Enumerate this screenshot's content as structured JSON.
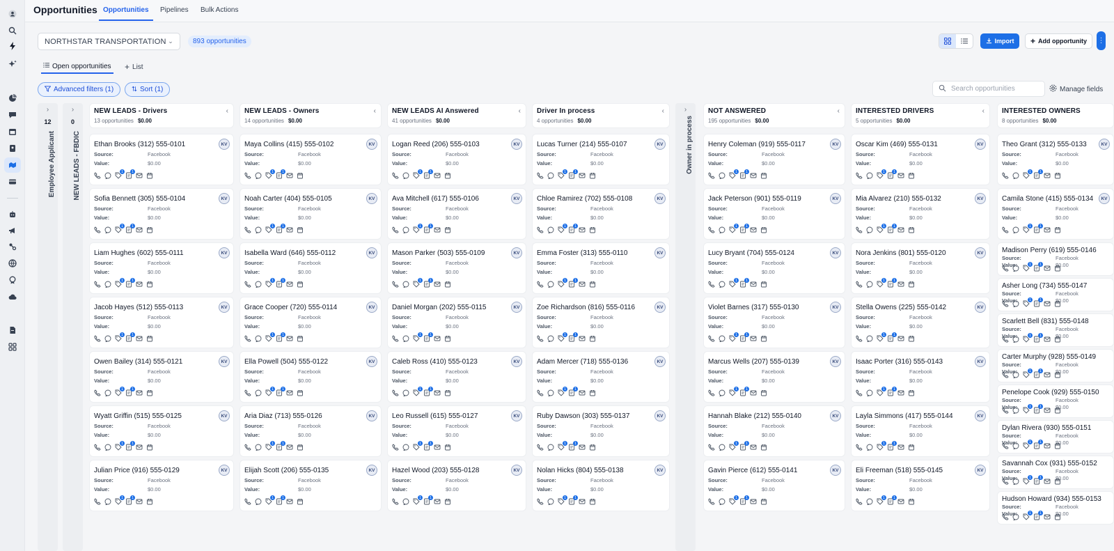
{
  "header": {
    "title": "Opportunities",
    "tabs": [
      "Opportunities",
      "Pipelines",
      "Bulk Actions"
    ]
  },
  "toolbar": {
    "pipeline": "NORTHSTAR TRANSPORTATION",
    "count": "893 opportunities",
    "import_label": "Import",
    "add_label": "Add opportunity"
  },
  "views": {
    "open": "Open opportunities",
    "list": "List"
  },
  "filters": {
    "advanced": "Advanced filters (1)",
    "sort": "Sort (1)",
    "search_placeholder": "Search opportunities",
    "manage_fields": "Manage fields"
  },
  "collapsed_columns": [
    {
      "label": "Employee Applicant",
      "count": "12"
    },
    {
      "label": "NEW LEADS - FBDIC",
      "count": "0"
    },
    {
      "label": "Owner in process",
      "count": ""
    }
  ],
  "card_labels": {
    "source": "Source:",
    "value": "Value:",
    "source_value": "Facebook",
    "amount": "$0.00",
    "avatar": "KV"
  },
  "columns": [
    {
      "title": "NEW LEADS - Drivers",
      "count": "13 opportunities",
      "amount": "$0.00",
      "cards": [
        "Ethan Brooks (312) 555-0101",
        "Liam Hughes (602) 555-0111"
      ]
    },
    {
      "title": "NEW LEADS - Owners",
      "count": "14 opportunities",
      "amount": "$0.00",
      "cards": []
    },
    {
      "title": "NEW LEADS AI Answered",
      "count": "41 opportunities",
      "amount": "$0.00",
      "cards": []
    },
    {
      "title": "Driver In process",
      "count": "4 opportunities",
      "amount": "$0.00",
      "cards": []
    },
    {
      "title": "NOT ANSWERED",
      "count": "195 opportunities",
      "amount": "$0.00",
      "cards": []
    },
    {
      "title": "INTERESTED DRIVERS",
      "count": "5 opportunities",
      "amount": "$0.00",
      "cards": []
    },
    {
      "title": "INTERESTED OWNERS",
      "count": "8 opportunities",
      "amount": "$0.00",
      "cards": []
    }
  ],
  "cards": {
    "col0": [
      "Ethan Brooks (312) 555-0101",
      "Sofia Bennett (305) 555-0104",
      "Liam Hughes (602) 555-0111",
      "Jacob Hayes (512) 555-0113",
      "Owen Bailey (314) 555-0121",
      "Wyatt Griffin (515) 555-0125",
      "Julian Price (916) 555-0129"
    ],
    "col1": [
      "Maya Collins (415) 555-0102",
      "Noah Carter (404) 555-0105",
      "Isabella Ward (646) 555-0112",
      "Grace Cooper (720) 555-0114",
      "Ella Powell (504) 555-0122",
      "Aria Diaz (713) 555-0126",
      "Elijah Scott (206) 555-0135"
    ],
    "col2": [
      "Logan Reed (206) 555-0103",
      "Ava Mitchell (617) 555-0106",
      "Mason Parker (503) 555-0109",
      "Daniel Morgan (202) 555-0115",
      "Caleb Ross (410) 555-0123",
      "Leo Russell (615) 555-0127",
      "Hazel Wood (203) 555-0128"
    ],
    "col3": [
      "Lucas Turner (214) 555-0107",
      "Chloe Ramirez (702) 555-0108",
      "Emma Foster (313) 555-0110",
      "Zoe Richardson (816) 555-0116",
      "Adam Mercer (718) 555-0136",
      "Ruby Dawson (303) 555-0137",
      "Nolan Hicks (804) 555-0138"
    ],
    "col4": [
      "Henry Coleman (919) 555-0117",
      "Jack Peterson (901) 555-0119",
      "Lucy Bryant (704) 555-0124",
      "Violet Barnes (317) 555-0130",
      "Marcus Wells (207) 555-0139",
      "Hannah Blake (212) 555-0140",
      "Gavin Pierce (612) 555-0141"
    ],
    "col5": [
      "Oscar Kim (469) 555-0131",
      "Mia Alvarez (210) 555-0132",
      "Nora Jenkins (801) 555-0120",
      "Stella Owens (225) 555-0142",
      "Isaac Porter (316) 555-0143",
      "Layla Simmons (417) 555-0144",
      "Eli Freeman (518) 555-0145"
    ],
    "col6": [
      "Theo Grant (312) 555-0133",
      "Camila Stone (415) 555-0134"
    ],
    "col6_compact": [
      "Madison Perry (619) 555-0146",
      "Asher Long (734) 555-0147",
      "Scarlett Bell (831) 555-0148",
      "Carter Murphy (928) 555-0149",
      "Penelope Cook (929) 555-0150",
      "Dylan Rivera (930) 555-0151",
      "Savannah Cox (931) 555-0152",
      "Hudson Howard (934) 555-0153"
    ]
  },
  "colors": {
    "accent": "#1d6fe6",
    "badge_bg": "#e3edfd"
  }
}
